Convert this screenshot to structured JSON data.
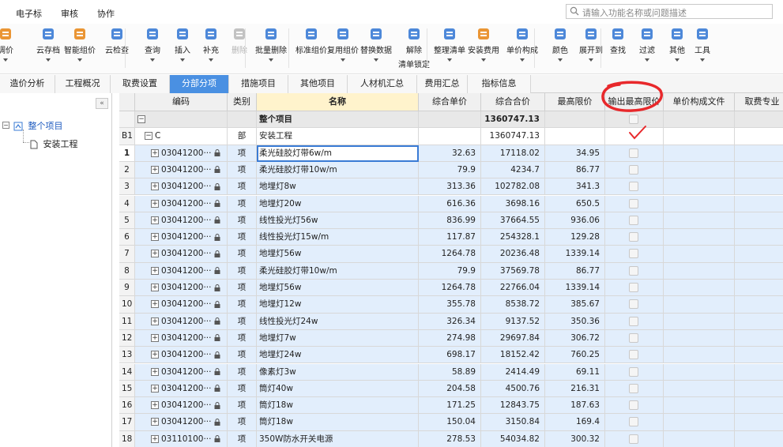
{
  "menu": [
    "电子标",
    "审核",
    "协作"
  ],
  "search": {
    "placeholder": "请输入功能名称或问题描述"
  },
  "toolbar": [
    {
      "label": "调价",
      "icon": "adjust-price-icon",
      "arrow": true
    },
    {
      "label": "云存档",
      "icon": "cloud-save-icon",
      "arrow": true
    },
    {
      "label": "智能组价",
      "icon": "smart-price-icon",
      "arrow": true
    },
    {
      "label": "云检查",
      "icon": "cloud-check-icon",
      "arrow": false
    },
    {
      "label": "查询",
      "icon": "query-icon",
      "arrow": true
    },
    {
      "label": "插入",
      "icon": "insert-icon",
      "arrow": true
    },
    {
      "label": "补充",
      "icon": "supplement-icon",
      "arrow": true
    },
    {
      "label": "删除",
      "icon": "delete-icon",
      "arrow": false,
      "disabled": true
    },
    {
      "label": "批量删除",
      "icon": "batch-delete-icon",
      "arrow": true
    },
    {
      "label": "标准组价",
      "icon": "standard-price-icon",
      "arrow": false
    },
    {
      "label": "复用组价",
      "icon": "reuse-price-icon",
      "arrow": true
    },
    {
      "label": "替换数据",
      "icon": "replace-data-icon",
      "arrow": true
    },
    {
      "label": "解除",
      "label2": "清单锁定",
      "icon": "unlock-icon",
      "arrow": false
    },
    {
      "label": "整理清单",
      "icon": "organize-list-icon",
      "arrow": true
    },
    {
      "label": "安装费用",
      "icon": "install-fee-icon",
      "arrow": true
    },
    {
      "label": "单价构成",
      "icon": "unit-price-icon",
      "arrow": true
    },
    {
      "label": "颜色",
      "icon": "color-icon",
      "arrow": true
    },
    {
      "label": "展开到",
      "icon": "expand-to-icon",
      "arrow": true
    },
    {
      "label": "查找",
      "icon": "find-icon",
      "arrow": false
    },
    {
      "label": "过滤",
      "icon": "filter-icon",
      "arrow": true
    },
    {
      "label": "其他",
      "icon": "other-icon",
      "arrow": true
    },
    {
      "label": "工具",
      "icon": "tools-icon",
      "arrow": true
    }
  ],
  "tabs": [
    "造价分析",
    "工程概况",
    "取费设置",
    "分部分项",
    "措施项目",
    "其他项目",
    "人材机汇总",
    "费用汇总",
    "指标信息"
  ],
  "active_tab": "分部分项",
  "tree": {
    "collapse": "«",
    "root": "整个项目",
    "child": "安装工程",
    "toggle": "−"
  },
  "columns": [
    "编码",
    "类别",
    "名称",
    "综合单价",
    "综合合价",
    "最高限价",
    "输出最高限价",
    "单价构成文件",
    "取费专业"
  ],
  "summary_rows": [
    {
      "num": "",
      "code": "",
      "type": "",
      "name": "整个项目",
      "unit_price": "",
      "total": "1360747.13",
      "max": ""
    },
    {
      "num": "B1",
      "code": "C",
      "type": "部",
      "name": "安装工程",
      "unit_price": "",
      "total": "1360747.13",
      "max": ""
    }
  ],
  "rows": [
    {
      "num": "1",
      "code": "03041200···",
      "type": "项",
      "name": "柔光硅胶灯带6w/m",
      "unit_price": "32.63",
      "total": "17118.02",
      "max": "34.95"
    },
    {
      "num": "2",
      "code": "03041200···",
      "type": "项",
      "name": "柔光硅胶灯带10w/m",
      "unit_price": "79.9",
      "total": "4234.7",
      "max": "86.77"
    },
    {
      "num": "3",
      "code": "03041200···",
      "type": "项",
      "name": "地埋灯8w",
      "unit_price": "313.36",
      "total": "102782.08",
      "max": "341.3"
    },
    {
      "num": "4",
      "code": "03041200···",
      "type": "项",
      "name": "地埋灯20w",
      "unit_price": "616.36",
      "total": "3698.16",
      "max": "650.5"
    },
    {
      "num": "5",
      "code": "03041200···",
      "type": "项",
      "name": "线性投光灯56w",
      "unit_price": "836.99",
      "total": "37664.55",
      "max": "936.06"
    },
    {
      "num": "6",
      "code": "03041200···",
      "type": "项",
      "name": "线性投光灯15w/m",
      "unit_price": "117.87",
      "total": "254328.1",
      "max": "129.28"
    },
    {
      "num": "7",
      "code": "03041200···",
      "type": "项",
      "name": "地埋灯56w",
      "unit_price": "1264.78",
      "total": "20236.48",
      "max": "1339.14"
    },
    {
      "num": "8",
      "code": "03041200···",
      "type": "项",
      "name": "柔光硅胶灯带10w/m",
      "unit_price": "79.9",
      "total": "37569.78",
      "max": "86.77"
    },
    {
      "num": "9",
      "code": "03041200···",
      "type": "项",
      "name": "地埋灯56w",
      "unit_price": "1264.78",
      "total": "22766.04",
      "max": "1339.14"
    },
    {
      "num": "10",
      "code": "03041200···",
      "type": "项",
      "name": "地埋灯12w",
      "unit_price": "355.78",
      "total": "8538.72",
      "max": "385.67"
    },
    {
      "num": "11",
      "code": "03041200···",
      "type": "项",
      "name": "线性投光灯24w",
      "unit_price": "326.34",
      "total": "9137.52",
      "max": "350.36"
    },
    {
      "num": "12",
      "code": "03041200···",
      "type": "项",
      "name": "地埋灯7w",
      "unit_price": "274.98",
      "total": "29697.84",
      "max": "306.72"
    },
    {
      "num": "13",
      "code": "03041200···",
      "type": "项",
      "name": "地埋灯24w",
      "unit_price": "698.17",
      "total": "18152.42",
      "max": "760.25"
    },
    {
      "num": "14",
      "code": "03041200···",
      "type": "项",
      "name": "像素灯3w",
      "unit_price": "58.89",
      "total": "2414.49",
      "max": "69.11"
    },
    {
      "num": "15",
      "code": "03041200···",
      "type": "项",
      "name": "筒灯40w",
      "unit_price": "204.58",
      "total": "4500.76",
      "max": "216.31"
    },
    {
      "num": "16",
      "code": "03041200···",
      "type": "项",
      "name": "筒灯18w",
      "unit_price": "171.25",
      "total": "12843.75",
      "max": "187.63"
    },
    {
      "num": "17",
      "code": "03041200···",
      "type": "项",
      "name": "筒灯18w",
      "unit_price": "150.04",
      "total": "3150.84",
      "max": "169.4"
    },
    {
      "num": "18",
      "code": "03110100···",
      "type": "项",
      "name": "350W防水开关电源",
      "unit_price": "278.53",
      "total": "54034.82",
      "max": "300.32"
    }
  ],
  "colors": {
    "accent": "#4a90e2",
    "annotation": "#e8282b",
    "row_highlight": "#e2eefc"
  }
}
